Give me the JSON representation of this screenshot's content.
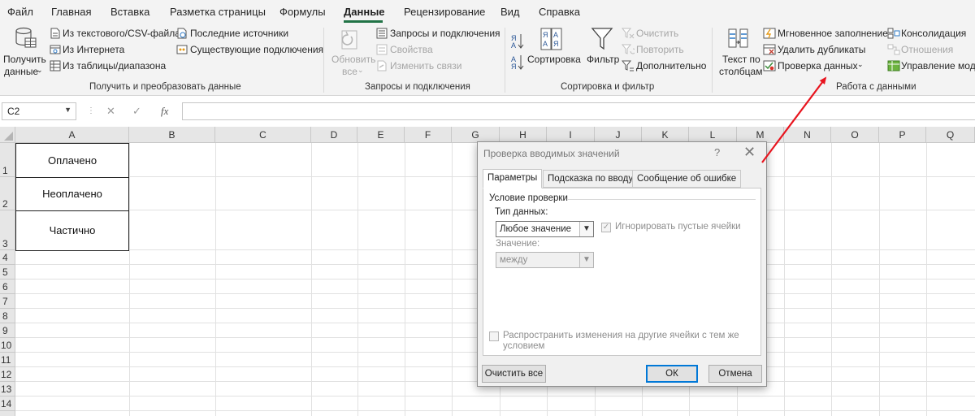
{
  "menu": {
    "tabs": [
      "Файл",
      "Главная",
      "Вставка",
      "Разметка страницы",
      "Формулы",
      "Данные",
      "Рецензирование",
      "Вид",
      "Справка"
    ],
    "active_tab": "Данные"
  },
  "ribbon": {
    "get_data": {
      "get_data_label_1": "Получить",
      "get_data_label_2": "данные",
      "from_text": "Из текстового/CSV-файла",
      "from_web": "Из Интернета",
      "from_table": "Из таблицы/диапазона",
      "recent_sources": "Последние источники",
      "existing_connections": "Существующие подключения",
      "group_label": "Получить и преобразовать данные"
    },
    "queries": {
      "refresh_1": "Обновить",
      "refresh_2": "все",
      "queries_connections": "Запросы и подключения",
      "properties": "Свойства",
      "edit_links": "Изменить связи",
      "group_label": "Запросы и подключения"
    },
    "sort_filter": {
      "sort": "Сортировка",
      "filter": "Фильтр",
      "clear": "Очистить",
      "reapply": "Повторить",
      "advanced": "Дополнительно",
      "group_label": "Сортировка и фильтр"
    },
    "data_tools": {
      "text_to_columns_1": "Текст по",
      "text_to_columns_2": "столбцам",
      "flash_fill": "Мгновенное заполнение",
      "remove_duplicates": "Удалить дубликаты",
      "data_validation": "Проверка данных",
      "consolidate": "Консолидация",
      "relationships": "Отношения",
      "data_model": "Управление модел",
      "group_label": "Работа с данными"
    }
  },
  "formula_bar": {
    "name_box": "C2",
    "cancel": "✕",
    "enter": "✓",
    "fx": "fx",
    "value": ""
  },
  "grid": {
    "columns": [
      "A",
      "B",
      "C",
      "D",
      "E",
      "F",
      "G",
      "H",
      "I",
      "J",
      "K",
      "L",
      "M",
      "N",
      "O",
      "P",
      "Q"
    ],
    "rows": [
      "1",
      "2",
      "3",
      "4",
      "5",
      "6",
      "7",
      "8",
      "9",
      "10",
      "11",
      "12",
      "13",
      "14"
    ],
    "cells": {
      "A1": "Оплачено",
      "A2": "Неоплачено",
      "A3": "Частично"
    }
  },
  "dialog": {
    "title": "Проверка вводимых значений",
    "help": "?",
    "close": "✕",
    "tabs": [
      "Параметры",
      "Подсказка по вводу",
      "Сообщение об ошибке"
    ],
    "active_tab": "Параметры",
    "section_title": "Условие проверки",
    "data_type_label": "Тип данных:",
    "data_type_value": "Любое значение",
    "ignore_blank_label": "Игнорировать пустые ячейки",
    "ignore_blank_checked": true,
    "value_label": "Значение:",
    "value_value": "между",
    "apply_all_line1": "Распространить изменения на другие ячейки с тем же",
    "apply_all_line2": "условием",
    "apply_all_checked": false,
    "clear_all_button": "Очистить все",
    "ok_button": "ОК",
    "cancel_button": "Отмена"
  },
  "colors": {
    "accent_green": "#217346",
    "annotation_arrow": "#e8141e",
    "ok_focus": "#0078d7"
  }
}
